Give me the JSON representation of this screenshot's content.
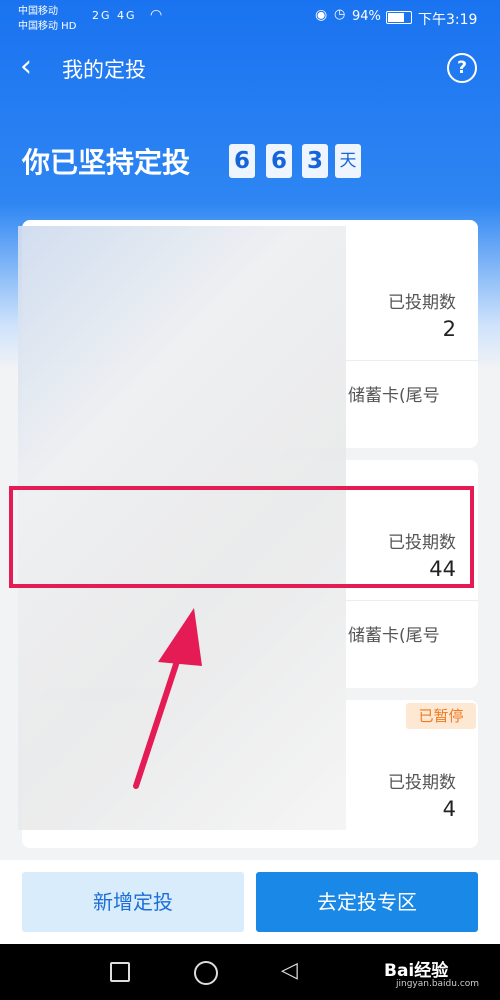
{
  "status": {
    "carrier1": "中国移动",
    "carrier2": "中国移动 HD",
    "icons": "2G 4G",
    "battery": "94%",
    "time": "下午3:19"
  },
  "nav": {
    "title": "我的定投",
    "help": "?"
  },
  "persist": {
    "text": "你已坚持定投",
    "digits": [
      "6",
      "6",
      "3"
    ],
    "unit": "天"
  },
  "cards": [
    {
      "label": "已投期数",
      "value": "2",
      "bank": "储蓄卡(尾号"
    },
    {
      "label": "已投期数",
      "value": "44",
      "bank": "储蓄卡(尾号"
    },
    {
      "label": "已投期数",
      "value": "4",
      "badge": "已暂停"
    }
  ],
  "buttons": {
    "new": "新增定投",
    "go": "去定投专区"
  },
  "watermark": {
    "brand": "Bai经验",
    "url": "jingyan.baidu.com"
  },
  "colors": {
    "accent": "#1a73f0",
    "highlight": "#e41b55",
    "paused": "#f07a22"
  }
}
